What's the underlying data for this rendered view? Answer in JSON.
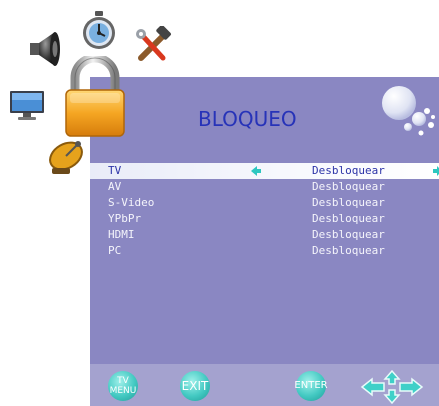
{
  "osd": {
    "title": "BLOQUEO"
  },
  "categories": [
    {
      "id": "sound",
      "icon": "speaker-icon"
    },
    {
      "id": "time",
      "icon": "stopwatch-icon"
    },
    {
      "id": "setup",
      "icon": "tools-icon"
    },
    {
      "id": "picture",
      "icon": "monitor-icon"
    },
    {
      "id": "lock",
      "icon": "padlock-icon",
      "active": true
    },
    {
      "id": "channel",
      "icon": "satellite-dish-icon"
    }
  ],
  "menu": {
    "selected_index": 0,
    "items": [
      {
        "label": "TV",
        "value": "Desbloquear"
      },
      {
        "label": "AV",
        "value": "Desbloquear"
      },
      {
        "label": "S-Video",
        "value": "Desbloquear"
      },
      {
        "label": "YPbPr",
        "value": "Desbloquear"
      },
      {
        "label": "HDMI",
        "value": "Desbloquear"
      },
      {
        "label": "PC",
        "value": "Desbloquear"
      }
    ]
  },
  "keys": {
    "menu_line1": "TV",
    "menu_line2": "MENU",
    "exit": "EXIT",
    "enter": "ENTER",
    "nav": "navigation-arrows-icon"
  },
  "colors": {
    "panel": "#8a87c2",
    "title": "#2733b8",
    "selected_text": "#2d34a8",
    "key_teal": "#43c9c2"
  }
}
